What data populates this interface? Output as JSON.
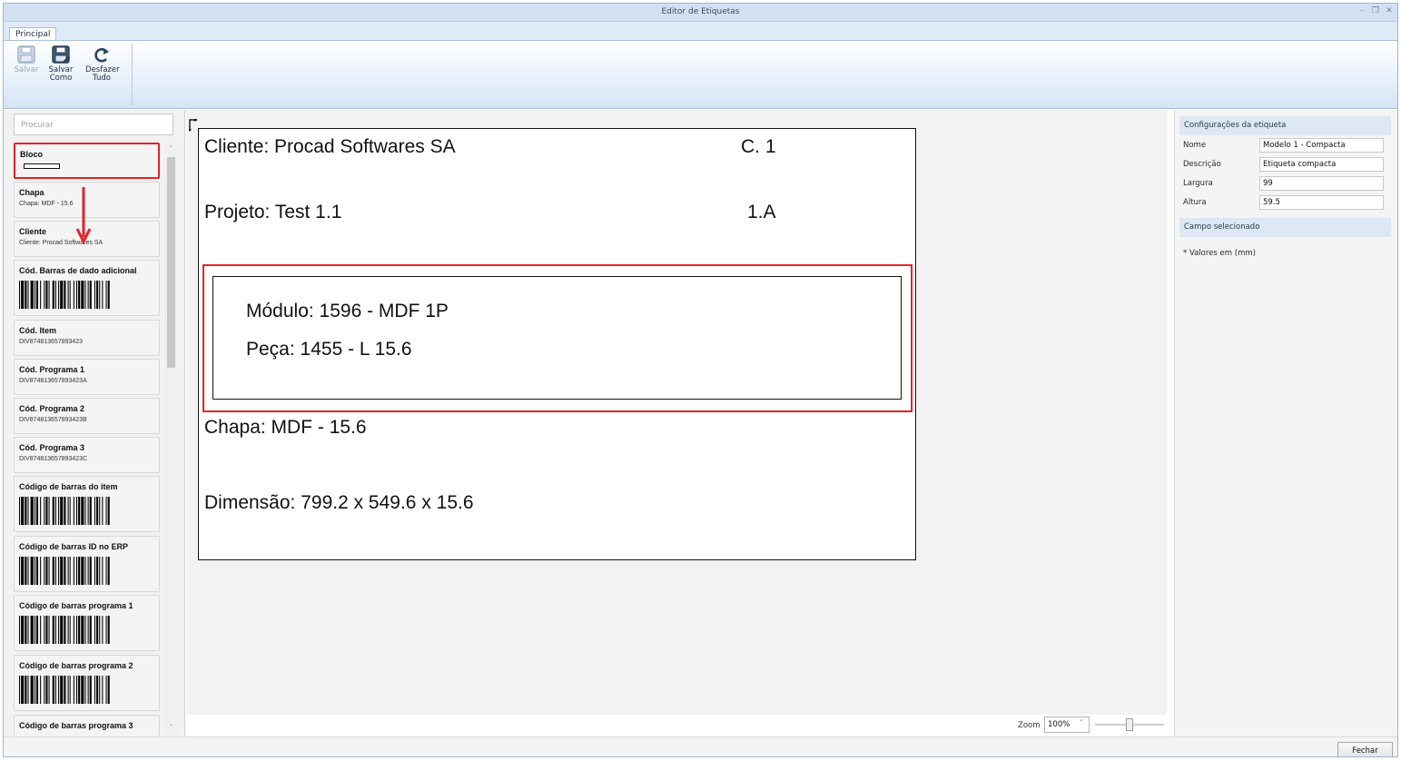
{
  "window": {
    "title": "Editor de Etiquetas",
    "controls": [
      "–",
      "❐",
      "✕"
    ]
  },
  "tabs": [
    {
      "label": "Principal"
    }
  ],
  "ribbon": {
    "buttons": [
      {
        "label": "Salvar",
        "icon": "save-icon",
        "enabled": false
      },
      {
        "label": "Salvar Como",
        "icon": "save-as-icon",
        "enabled": true
      },
      {
        "label": "Desfazer Tudo",
        "icon": "undo-all-icon",
        "enabled": true
      }
    ]
  },
  "search": {
    "placeholder": "Procurar"
  },
  "fields": [
    {
      "label": "Bloco",
      "kind": "block"
    },
    {
      "label": "Chapa",
      "value": "Chapa: MDF - 15.6",
      "kind": "text"
    },
    {
      "label": "Cliente",
      "value": "Cliente: Procad Softwares SA",
      "kind": "text"
    },
    {
      "label": "Cód. Barras de dado adicional",
      "kind": "barcode"
    },
    {
      "label": "Cód. Item",
      "value": "DIV874813657893423",
      "kind": "text"
    },
    {
      "label": "Cód. Programa 1",
      "value": "DIV874813657893423A",
      "kind": "text"
    },
    {
      "label": "Cód. Programa 2",
      "value": "DIV874813657893423B",
      "kind": "text"
    },
    {
      "label": "Cód. Programa 3",
      "value": "DIV874813657893423C",
      "kind": "text"
    },
    {
      "label": "Código de barras do item",
      "kind": "barcode"
    },
    {
      "label": "Código de barras ID no ERP",
      "kind": "barcode"
    },
    {
      "label": "Código de barras programa 1",
      "kind": "barcode"
    },
    {
      "label": "Código de barras programa 2",
      "kind": "barcode"
    },
    {
      "label": "Código de barras programa 3",
      "kind": "barcode"
    }
  ],
  "label_preview": {
    "cliente": "Cliente: Procad Softwares SA",
    "c1": "C. 1",
    "projeto": "Projeto: Test 1.1",
    "code": "1.A",
    "modulo": "Módulo: 1596 - MDF 1P",
    "peca": "Peça: 1455 - L 15.6",
    "chapa": "Chapa: MDF - 15.6",
    "dimensao": "Dimensão: 799.2 x 549.6 x 15.6"
  },
  "config": {
    "header": "Configurações da etiqueta",
    "rows": [
      {
        "label": "Nome",
        "value": "Modelo 1 - Compacta"
      },
      {
        "label": "Descrição",
        "value": "Etiqueta compacta"
      },
      {
        "label": "Largura",
        "value": "99"
      },
      {
        "label": "Altura",
        "value": "59.5"
      }
    ],
    "selected_header": "Campo selecionado",
    "note": "* Valores em (mm)"
  },
  "zoom": {
    "label": "Zoom",
    "value": "100%",
    "level_fraction": 0.5
  },
  "footer": {
    "close_label": "Fechar"
  },
  "colors": {
    "highlight": "#e0242a",
    "accent": "#d2e1f2"
  }
}
